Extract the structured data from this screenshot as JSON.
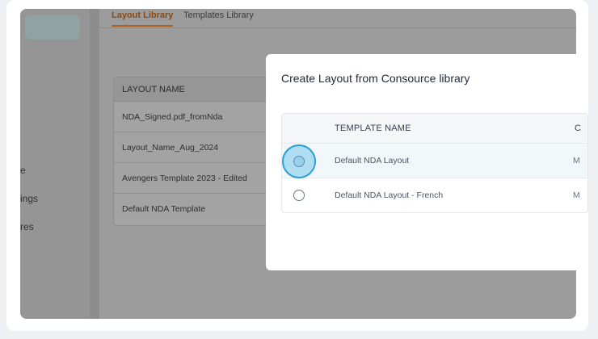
{
  "sidebar": {
    "items": [
      {
        "label": "e"
      },
      {
        "label": "ings"
      },
      {
        "label": "res"
      }
    ]
  },
  "tabs": [
    {
      "label": "Layout Library",
      "active": true
    },
    {
      "label": "Templates Library",
      "active": false
    }
  ],
  "layouts_table": {
    "header": "LAYOUT NAME",
    "rows": [
      "NDA_Signed.pdf_fromNda",
      "Layout_Name_Aug_2024",
      "Avengers Template 2023 - Edited",
      "Default NDA Template"
    ]
  },
  "modal": {
    "title": "Create Layout from Consource library",
    "table": {
      "header_name": "TEMPLATE NAME",
      "header_next_partial": "C",
      "rows": [
        {
          "name": "Default NDA Layout",
          "next_partial": "M",
          "selected": true
        },
        {
          "name": "Default NDA Layout - French",
          "next_partial": "M",
          "selected": false
        }
      ]
    }
  },
  "colors": {
    "accent_tab": "#b0601a",
    "radio_focus": "#2a9fd6"
  }
}
